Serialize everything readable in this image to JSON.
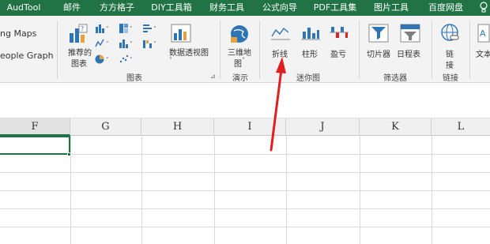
{
  "tabs": [
    "AudTool",
    "邮件",
    "方方格子",
    "DIY工具箱",
    "财务工具",
    "公式向导",
    "PDF工具集",
    "图片工具",
    "百度网盘"
  ],
  "ribbon": {
    "addins": [
      "ng Maps",
      "eople Graph"
    ],
    "charts": {
      "recommended_line1": "推荐的",
      "recommended_line2": "图表",
      "pivot_chart": "数据透视图",
      "group_label": "图表"
    },
    "tour": {
      "map3d_line1": "三维地",
      "map3d_line2": "图",
      "map3d_arrow": "˅",
      "group_label": "演示"
    },
    "sparklines": {
      "line": "折线",
      "column": "柱形",
      "winloss": "盈亏",
      "group_label": "迷你图"
    },
    "filters": {
      "slicer": "切片器",
      "timeline": "日程表",
      "group_label": "筛选器"
    },
    "links": {
      "link_line1": "链",
      "link_line2": "接",
      "group_label": "链接"
    },
    "text": {
      "label": "文本"
    }
  },
  "columns": [
    "F",
    "G",
    "H",
    "I",
    "J",
    "K",
    "L"
  ],
  "colors": {
    "accent": "#217346",
    "arrow": "#e02020"
  }
}
